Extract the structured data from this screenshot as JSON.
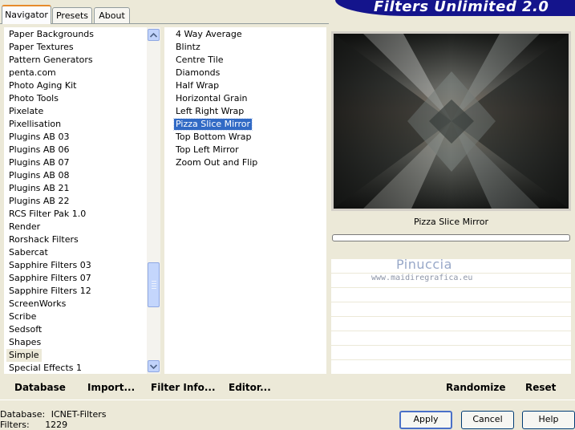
{
  "tabs": [
    {
      "label": "Navigator",
      "active": true
    },
    {
      "label": "Presets",
      "active": false
    },
    {
      "label": "About",
      "active": false
    }
  ],
  "banner_title": "Filters Unlimited 2.0",
  "categories": [
    "Paper Backgrounds",
    "Paper Textures",
    "Pattern Generators",
    "penta.com",
    "Photo Aging Kit",
    "Photo Tools",
    "Pixelate",
    "Pixellisation",
    "Plugins AB 03",
    "Plugins AB 06",
    "Plugins AB 07",
    "Plugins AB 08",
    "Plugins AB 21",
    "Plugins AB 22",
    "RCS Filter Pak 1.0",
    "Render",
    "Rorshack Filters",
    "Sabercat",
    "Sapphire Filters 03",
    "Sapphire Filters 07",
    "Sapphire Filters 12",
    "ScreenWorks",
    "Scribe",
    "Sedsoft",
    "Shapes",
    "Simple",
    "Special Effects 1"
  ],
  "selected_category": "Simple",
  "filters": [
    "4 Way Average",
    "Blintz",
    "Centre Tile",
    "Diamonds",
    "Half Wrap",
    "Horizontal Grain",
    "Left Right Wrap",
    "Pizza Slice Mirror",
    "Top Bottom Wrap",
    "Top Left Mirror",
    "Zoom Out and Flip"
  ],
  "selected_filter": "Pizza Slice Mirror",
  "preview": {
    "filter_name": "Pizza Slice Mirror",
    "watermark": "Pinuccia",
    "watermark_url": "www.maidiregrafica.eu"
  },
  "actions": {
    "database": "Database",
    "import": "Import...",
    "filter_info": "Filter Info...",
    "editor": "Editor...",
    "randomize": "Randomize",
    "reset": "Reset"
  },
  "footer": {
    "database_label": "Database:",
    "database_value": "ICNET-Filters",
    "filters_label": "Filters:",
    "filters_value": "1229"
  },
  "buttons": {
    "apply": "Apply",
    "cancel": "Cancel",
    "help": "Help"
  },
  "icons": {
    "scroll_up": "arrow-up-icon",
    "scroll_down": "arrow-down-icon"
  }
}
